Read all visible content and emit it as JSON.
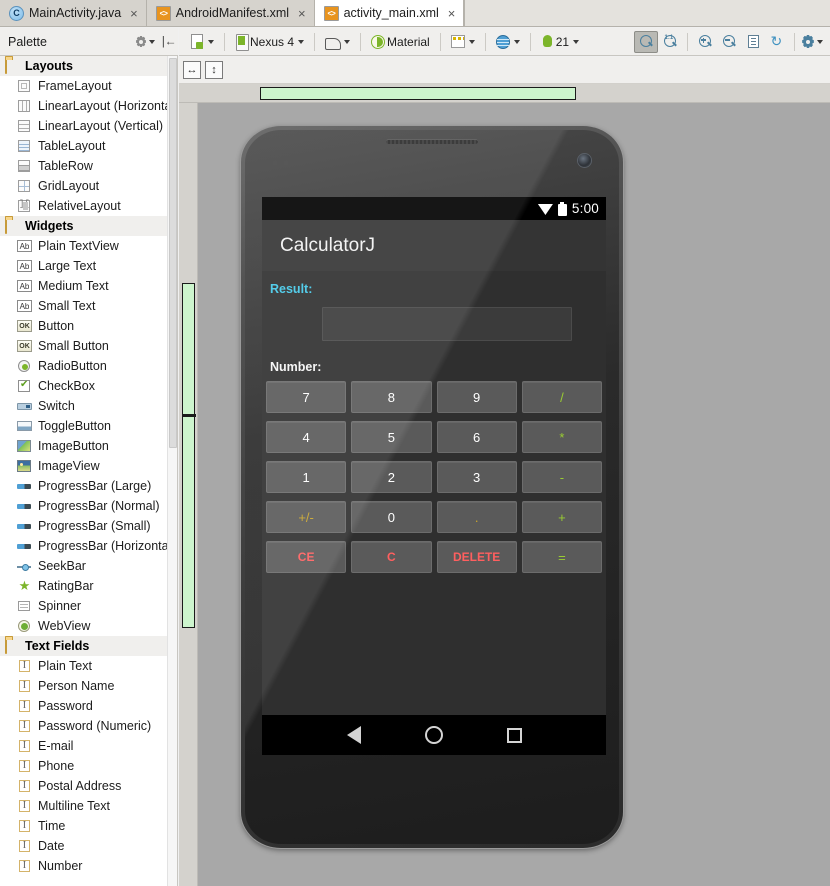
{
  "editor_tabs": [
    {
      "label": "MainActivity.java",
      "icon": "java-class-icon",
      "active": false
    },
    {
      "label": "AndroidManifest.xml",
      "icon": "xml-file-icon",
      "active": false
    },
    {
      "label": "activity_main.xml",
      "icon": "xml-file-icon",
      "active": true
    }
  ],
  "tab_close_glyph": "×",
  "palette": {
    "title": "Palette",
    "settings_icon": "gear-icon",
    "collapse_icon": "collapse-all-icon",
    "groups": [
      {
        "label": "Layouts",
        "icon": "folder-icon",
        "items": [
          {
            "label": "FrameLayout",
            "icon": "frame-layout-icon"
          },
          {
            "label": "LinearLayout (Horizontal)",
            "icon": "linear-layout-horizontal-icon"
          },
          {
            "label": "LinearLayout (Vertical)",
            "icon": "linear-layout-vertical-icon"
          },
          {
            "label": "TableLayout",
            "icon": "table-layout-icon"
          },
          {
            "label": "TableRow",
            "icon": "table-row-icon"
          },
          {
            "label": "GridLayout",
            "icon": "grid-layout-icon"
          },
          {
            "label": "RelativeLayout",
            "icon": "relative-layout-icon"
          }
        ]
      },
      {
        "label": "Widgets",
        "icon": "folder-icon",
        "items": [
          {
            "label": "Plain TextView",
            "icon": "textview-icon"
          },
          {
            "label": "Large Text",
            "icon": "textview-icon"
          },
          {
            "label": "Medium Text",
            "icon": "textview-icon"
          },
          {
            "label": "Small Text",
            "icon": "textview-icon"
          },
          {
            "label": "Button",
            "icon": "button-icon"
          },
          {
            "label": "Small Button",
            "icon": "button-icon"
          },
          {
            "label": "RadioButton",
            "icon": "radio-button-icon"
          },
          {
            "label": "CheckBox",
            "icon": "checkbox-icon"
          },
          {
            "label": "Switch",
            "icon": "switch-icon"
          },
          {
            "label": "ToggleButton",
            "icon": "toggle-button-icon"
          },
          {
            "label": "ImageButton",
            "icon": "image-button-icon"
          },
          {
            "label": "ImageView",
            "icon": "image-view-icon"
          },
          {
            "label": "ProgressBar (Large)",
            "icon": "progress-bar-icon"
          },
          {
            "label": "ProgressBar (Normal)",
            "icon": "progress-bar-icon"
          },
          {
            "label": "ProgressBar (Small)",
            "icon": "progress-bar-icon"
          },
          {
            "label": "ProgressBar (Horizontal)",
            "icon": "progress-bar-icon"
          },
          {
            "label": "SeekBar",
            "icon": "seek-bar-icon"
          },
          {
            "label": "RatingBar",
            "icon": "rating-bar-icon"
          },
          {
            "label": "Spinner",
            "icon": "spinner-icon"
          },
          {
            "label": "WebView",
            "icon": "web-view-icon"
          }
        ]
      },
      {
        "label": "Text Fields",
        "icon": "folder-icon",
        "items": [
          {
            "label": "Plain Text",
            "icon": "text-field-icon"
          },
          {
            "label": "Person Name",
            "icon": "text-field-icon"
          },
          {
            "label": "Password",
            "icon": "text-field-icon"
          },
          {
            "label": "Password (Numeric)",
            "icon": "text-field-icon"
          },
          {
            "label": "E-mail",
            "icon": "text-field-icon"
          },
          {
            "label": "Phone",
            "icon": "text-field-icon"
          },
          {
            "label": "Postal Address",
            "icon": "text-field-icon"
          },
          {
            "label": "Multiline Text",
            "icon": "text-field-icon"
          },
          {
            "label": "Time",
            "icon": "text-field-icon"
          },
          {
            "label": "Date",
            "icon": "text-field-icon"
          },
          {
            "label": "Number",
            "icon": "text-field-icon"
          }
        ]
      }
    ]
  },
  "design_toolbar": {
    "new_device_icon": "new-device-icon",
    "device_label": "Nexus 4",
    "device_icon": "device-icon",
    "orientation_icon": "orientation-icon",
    "theme_label": "Material",
    "theme_icon": "theme-icon",
    "locale_icon": "locale-icon",
    "language_icon": "globe-icon",
    "api_label": "21",
    "api_icon": "android-icon",
    "dropdown_caret": "chevron-down-icon",
    "right_tools": [
      {
        "name": "pan-tool-icon",
        "pressed": true
      },
      {
        "name": "zoom-actual-size-icon",
        "pressed": false
      },
      {
        "name": "zoom-in-icon",
        "pressed": false
      },
      {
        "name": "zoom-out-icon",
        "pressed": false
      },
      {
        "name": "zoom-fit-icon",
        "pressed": false
      },
      {
        "name": "refresh-icon",
        "pressed": false
      },
      {
        "name": "preview-settings-icon",
        "pressed": false
      }
    ]
  },
  "resize_handles": {
    "horizontal_glyph": "↔",
    "vertical_glyph": "↕"
  },
  "device_preview": {
    "statusbar": {
      "time": "5:00",
      "wifi_icon": "wifi-icon",
      "battery_icon": "battery-icon"
    },
    "app_title": "CalculatorJ",
    "result_label": "Result:",
    "result_value": "",
    "result_placeholder": "",
    "number_label": "Number:",
    "colors": {
      "result_label": "#44c8e8",
      "operator": "#9acd32",
      "destructive": "#ff5f5f",
      "sign": "#c8a42c",
      "key_face": "#5a5a5a",
      "screen_bg": "#2f2f2f",
      "appbar": "#343434"
    },
    "keypad": [
      [
        {
          "label": "7",
          "style": "num"
        },
        {
          "label": "8",
          "style": "num"
        },
        {
          "label": "9",
          "style": "num"
        },
        {
          "label": "/",
          "style": "op"
        }
      ],
      [
        {
          "label": "4",
          "style": "num"
        },
        {
          "label": "5",
          "style": "num"
        },
        {
          "label": "6",
          "style": "num"
        },
        {
          "label": "*",
          "style": "op"
        }
      ],
      [
        {
          "label": "1",
          "style": "num"
        },
        {
          "label": "2",
          "style": "num"
        },
        {
          "label": "3",
          "style": "num"
        },
        {
          "label": "-",
          "style": "op"
        }
      ],
      [
        {
          "label": "+/-",
          "style": "sign"
        },
        {
          "label": "0",
          "style": "num"
        },
        {
          "label": ".",
          "style": "dot"
        },
        {
          "label": "+",
          "style": "op"
        }
      ],
      [
        {
          "label": "CE",
          "style": "warn"
        },
        {
          "label": "C",
          "style": "warn"
        },
        {
          "label": "DELETE",
          "style": "warn"
        },
        {
          "label": "=",
          "style": "op"
        }
      ]
    ],
    "navbar": {
      "back_icon": "nav-back-icon",
      "home_icon": "nav-home-icon",
      "recents_icon": "nav-recents-icon"
    }
  }
}
